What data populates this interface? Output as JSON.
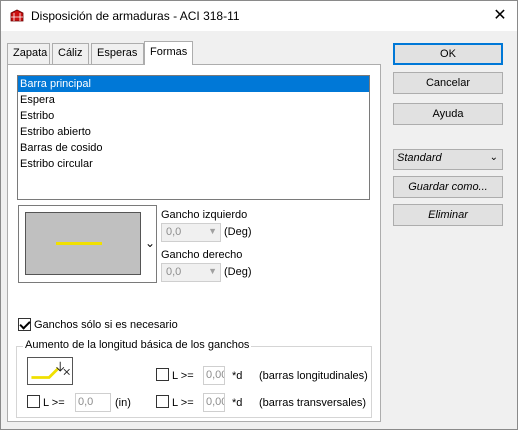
{
  "window": {
    "title": "Disposición de armaduras - ACI 318-11",
    "close_glyph": "✕"
  },
  "tabs": [
    {
      "label": "Zapata"
    },
    {
      "label": "Cáliz"
    },
    {
      "label": "Esperas"
    },
    {
      "label": "Formas",
      "active": true
    }
  ],
  "shapes_list": [
    "Barra principal",
    "Espera",
    "Estribo",
    "Estribo abierto",
    "Barras de cosido",
    "Estribo circular"
  ],
  "selected_shape": "Barra principal",
  "hooks": {
    "left_label": "Gancho izquierdo",
    "left_value": "0,0",
    "left_unit": "(Deg)",
    "right_label": "Gancho derecho",
    "right_value": "0,0",
    "right_unit": "(Deg)"
  },
  "only_if_needed": {
    "label": "Ganchos sólo si es necesario",
    "checked": true
  },
  "extension_group": {
    "legend": "Aumento de la longitud básica de los ganchos",
    "row1": {
      "prefix": "L >=",
      "value": "0,00",
      "suffix": "*d",
      "note": "(barras longitudinales)",
      "checked": false
    },
    "row2": {
      "prefix": "L >=",
      "value": "0,00",
      "suffix": "*d",
      "note": "(barras transversales)",
      "checked": false
    },
    "row_in": {
      "prefix": "L >=",
      "value": "0,0",
      "unit": "(in)",
      "checked": false
    }
  },
  "buttons": {
    "ok": "OK",
    "cancel": "Cancelar",
    "help": "Ayuda",
    "save_as": "Guardar como...",
    "delete": "Eliminar"
  },
  "style_combo": {
    "value": "Standard"
  },
  "colors": {
    "selection": "#0078d7",
    "bar_preview": "#f0e000",
    "title_icon": "#cc1111"
  }
}
